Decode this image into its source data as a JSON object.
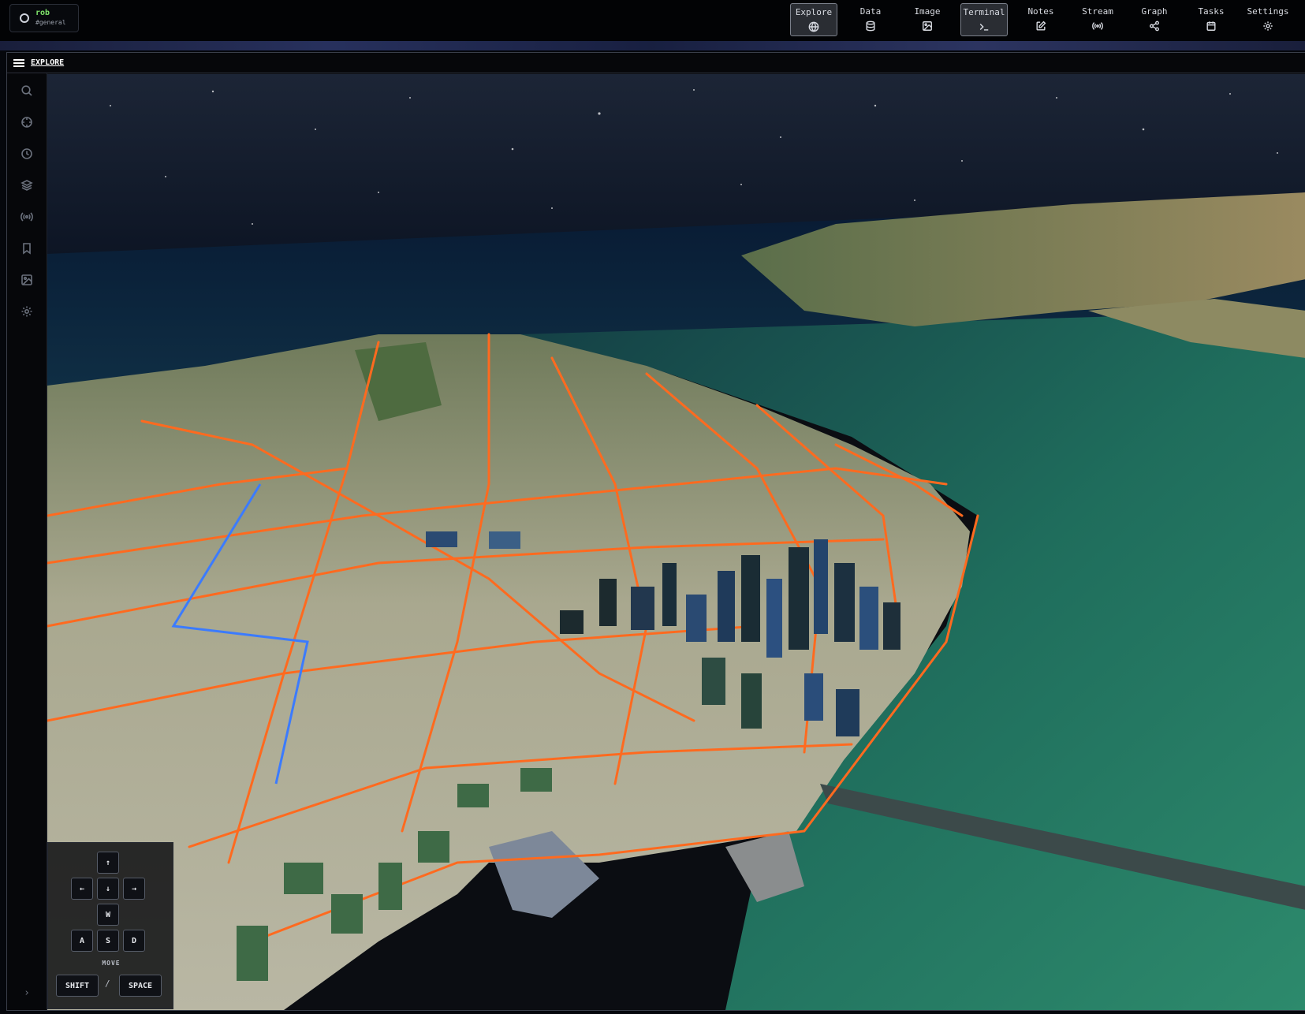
{
  "workspace": {
    "user": "rob",
    "channel": "#general"
  },
  "tabs": [
    {
      "label": "Explore",
      "icon": "globe-icon",
      "active": true
    },
    {
      "label": "Data",
      "icon": "database-icon",
      "active": false
    },
    {
      "label": "Image",
      "icon": "image-icon",
      "active": false
    },
    {
      "label": "Terminal",
      "icon": "terminal-icon",
      "active": true
    },
    {
      "label": "Notes",
      "icon": "edit-icon",
      "active": false
    },
    {
      "label": "Stream",
      "icon": "broadcast-icon",
      "active": false
    },
    {
      "label": "Graph",
      "icon": "share-icon",
      "active": false
    },
    {
      "label": "Tasks",
      "icon": "calendar-icon",
      "active": false
    },
    {
      "label": "Settings",
      "icon": "gear-icon",
      "active": false
    }
  ],
  "panel": {
    "title": "EXPLORE"
  },
  "sidebar": [
    {
      "icon": "search-icon"
    },
    {
      "icon": "crosshair-icon"
    },
    {
      "icon": "clock-icon"
    },
    {
      "icon": "layers-icon"
    },
    {
      "icon": "broadcast-icon"
    },
    {
      "icon": "bookmark-icon"
    },
    {
      "icon": "image-icon"
    },
    {
      "icon": "gear-icon"
    }
  ],
  "sidebar_toggle": "›",
  "controls": {
    "up": "↑",
    "left": "←",
    "down": "↓",
    "right": "→",
    "w": "W",
    "a": "A",
    "s": "S",
    "d": "D",
    "move_label": "MOVE",
    "shift": "SHIFT",
    "separator": "/",
    "space": "SPACE"
  },
  "colors": {
    "road": "#ff6a1f",
    "transit": "#3b7bff",
    "water": "#1e6a5a",
    "ocean_far": "#0b1f38",
    "land": "#b9b59a",
    "sky": "#0c1422"
  }
}
